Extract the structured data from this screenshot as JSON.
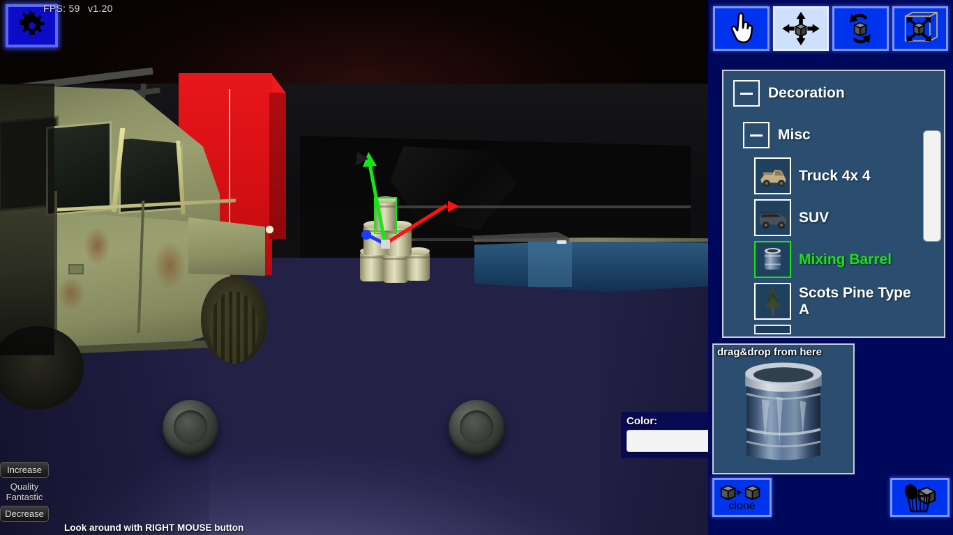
{
  "hud": {
    "fps_text": "FPS: 59",
    "version_text": "v1.20",
    "hint": "Look around with RIGHT MOUSE button",
    "settings_icon": "gear-icon"
  },
  "quality": {
    "increase_label": "Increase",
    "status_line1": "Quality",
    "status_line2": "Fantastic",
    "decrease_label": "Decrease"
  },
  "color_picker": {
    "label": "Color:",
    "value": "#f4f4f4"
  },
  "toolbar": {
    "tools": [
      {
        "name": "select-tool",
        "icon": "hand-pointer-icon",
        "active": false
      },
      {
        "name": "move-tool",
        "icon": "move-arrows-icon",
        "active": true
      },
      {
        "name": "rotate-tool",
        "icon": "rotate-arrows-icon",
        "active": false
      },
      {
        "name": "scale-tool",
        "icon": "scale-box-icon",
        "active": false
      }
    ]
  },
  "browser": {
    "root": {
      "label": "Decoration",
      "expanded": true
    },
    "group": {
      "label": "Misc",
      "expanded": true
    },
    "items": [
      {
        "label": "Truck 4x 4",
        "icon": "truck-thumbnail",
        "selected": false
      },
      {
        "label": "SUV",
        "icon": "suv-thumbnail",
        "selected": false
      },
      {
        "label": "Mixing Barrel",
        "icon": "barrel-thumbnail",
        "selected": true
      },
      {
        "label": "Scots Pine Type A",
        "icon": "pine-tree-thumbnail",
        "selected": false
      }
    ],
    "selected_color": "#19e512",
    "panel_color": "#2a4d70"
  },
  "preview": {
    "label": "drag&drop from here",
    "object": "mixing-barrel-model"
  },
  "actions": {
    "clone_label": "clone",
    "clone_icon": "duplicate-cubes-icon",
    "delete_icon": "trash-can-icon"
  },
  "viewport": {
    "gizmo": {
      "mode": "translate",
      "axis_x_color": "#ff1111",
      "axis_y_color": "#14e814",
      "axis_z_color": "#1a3cff"
    },
    "objects": [
      "suv-vehicle",
      "red-container",
      "barrel-stack",
      "blue-wall"
    ],
    "joystick_left": "move-joystick",
    "joystick_right": "look-joystick"
  },
  "palette": {
    "sidebar_bg": "#00085c",
    "panel_bg": "#2a4d70",
    "button_blue": "#0033ee",
    "button_active": "#cfe0ff",
    "floor": "#6f6b95"
  }
}
